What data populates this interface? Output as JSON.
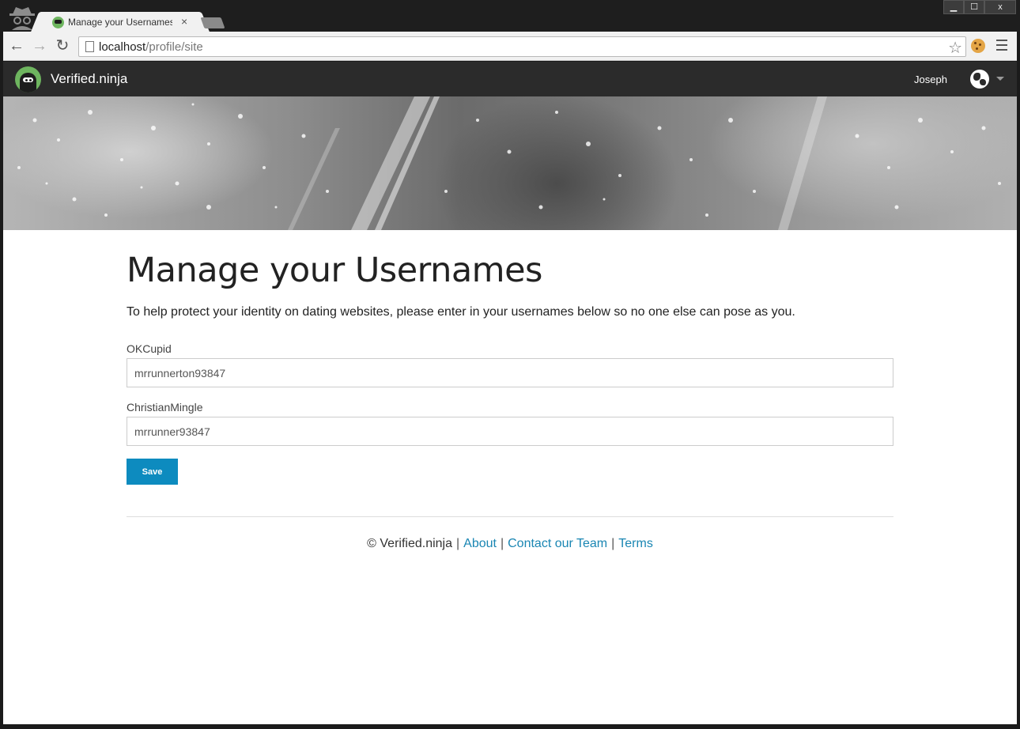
{
  "browser": {
    "tab_title": "Manage your Usernames",
    "tab_close": "×",
    "url_host": "localhost",
    "url_path": "/profile/site",
    "window_controls": {
      "minimize": "▁",
      "maximize": "☐",
      "close": "x"
    }
  },
  "navbar": {
    "brand": "Verified.ninja",
    "user": "Joseph",
    "icons": {
      "logo": "ninja-logo",
      "globe": "globe-icon",
      "caret": "caret-down-icon"
    }
  },
  "main": {
    "title": "Manage your Usernames",
    "intro": "To help protect your identity on dating websites, please enter in your usernames below so no one else can pose as you.",
    "fields": [
      {
        "label": "OKCupid",
        "value": "mrrunnerton93847"
      },
      {
        "label": "ChristianMingle",
        "value": "mrrunner93847"
      }
    ],
    "save_label": "Save"
  },
  "footer": {
    "copyright": "© Verified.ninja",
    "links": [
      "About",
      "Contact our Team",
      "Terms"
    ],
    "separator": "|"
  },
  "colors": {
    "navbar_bg": "#2b2b2b",
    "accent_button": "#0d8bbf",
    "link": "#1a86b3",
    "logo_green": "#6eb55f"
  }
}
